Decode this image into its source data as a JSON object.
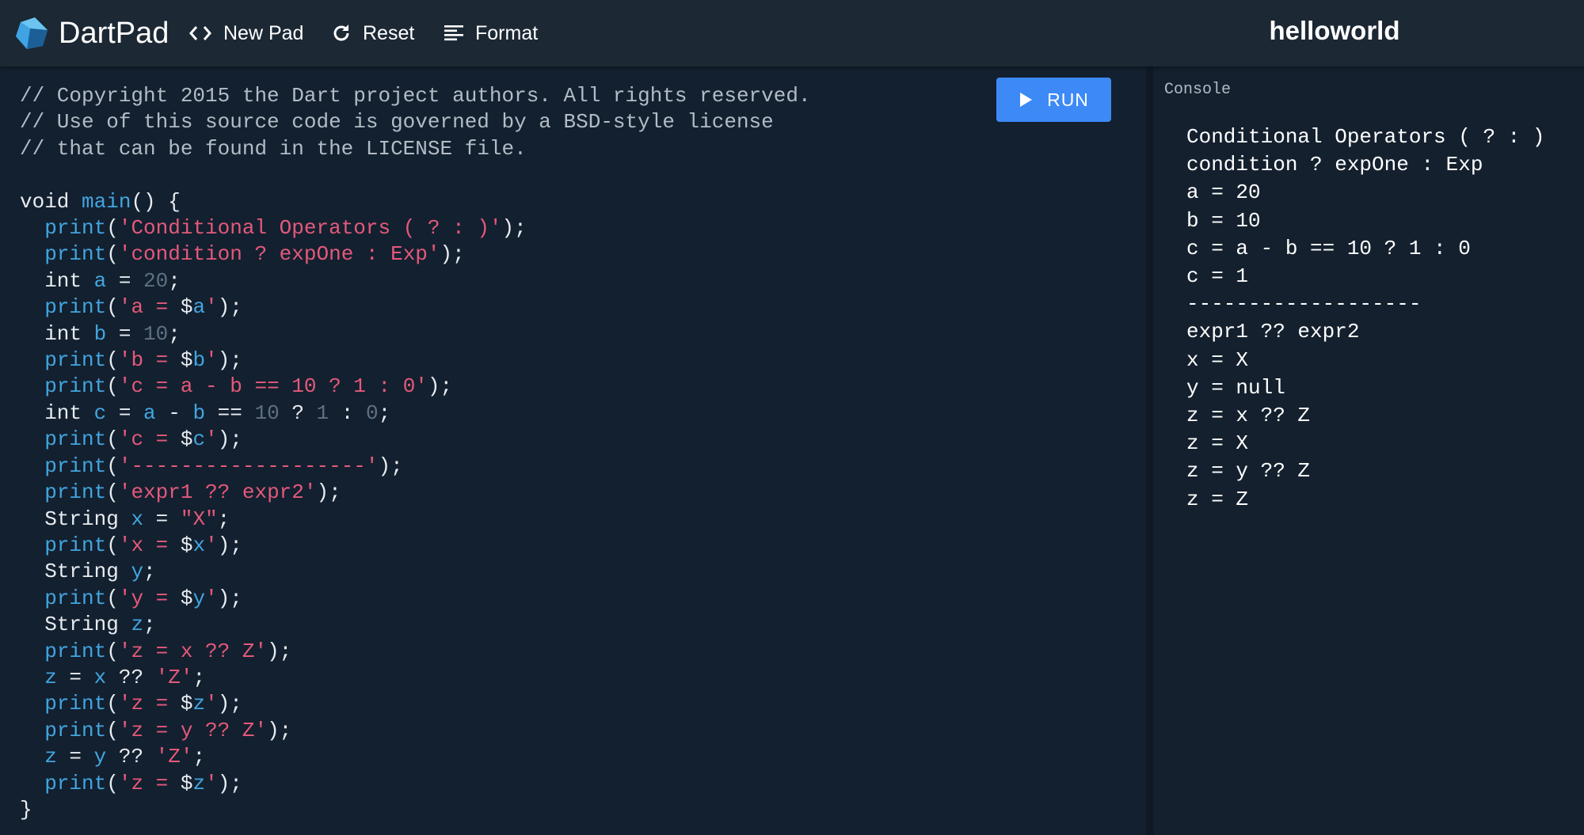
{
  "app": {
    "name": "DartPad",
    "pad_title": "helloworld"
  },
  "toolbar": {
    "new_pad_label": "New Pad",
    "new_pad_icon": "code-brackets-icon",
    "reset_label": "Reset",
    "reset_icon": "refresh-icon",
    "format_label": "Format",
    "format_icon": "align-left-icon"
  },
  "editor": {
    "run_label": "RUN",
    "run_icon": "play-icon",
    "lines": [
      [
        {
          "t": "cm",
          "v": "// Copyright 2015 the Dart project authors. All rights reserved."
        }
      ],
      [
        {
          "t": "cm",
          "v": "// Use of this source code is governed by a BSD-style license"
        }
      ],
      [
        {
          "t": "cm",
          "v": "// that can be found in the LICENSE file."
        }
      ],
      [],
      [
        {
          "t": "kw",
          "v": "void "
        },
        {
          "t": "fn",
          "v": "main"
        },
        {
          "t": "pu",
          "v": "() {"
        }
      ],
      [
        {
          "t": "pu",
          "v": "  "
        },
        {
          "t": "fn",
          "v": "print"
        },
        {
          "t": "pu",
          "v": "("
        },
        {
          "t": "st",
          "v": "'Conditional Operators ( ? : )'"
        },
        {
          "t": "pu",
          "v": ");"
        }
      ],
      [
        {
          "t": "pu",
          "v": "  "
        },
        {
          "t": "fn",
          "v": "print"
        },
        {
          "t": "pu",
          "v": "("
        },
        {
          "t": "st",
          "v": "'condition ? expOne : Exp'"
        },
        {
          "t": "pu",
          "v": ");"
        }
      ],
      [
        {
          "t": "kw",
          "v": "  int "
        },
        {
          "t": "vr",
          "v": "a"
        },
        {
          "t": "pu",
          "v": " = "
        },
        {
          "t": "nm",
          "v": "20"
        },
        {
          "t": "pu",
          "v": ";"
        }
      ],
      [
        {
          "t": "pu",
          "v": "  "
        },
        {
          "t": "fn",
          "v": "print"
        },
        {
          "t": "pu",
          "v": "("
        },
        {
          "t": "st",
          "v": "'a = "
        },
        {
          "t": "pu",
          "v": "$"
        },
        {
          "t": "vr",
          "v": "a"
        },
        {
          "t": "st",
          "v": "'"
        },
        {
          "t": "pu",
          "v": ");"
        }
      ],
      [
        {
          "t": "kw",
          "v": "  int "
        },
        {
          "t": "vr",
          "v": "b"
        },
        {
          "t": "pu",
          "v": " = "
        },
        {
          "t": "nm",
          "v": "10"
        },
        {
          "t": "pu",
          "v": ";"
        }
      ],
      [
        {
          "t": "pu",
          "v": "  "
        },
        {
          "t": "fn",
          "v": "print"
        },
        {
          "t": "pu",
          "v": "("
        },
        {
          "t": "st",
          "v": "'b = "
        },
        {
          "t": "pu",
          "v": "$"
        },
        {
          "t": "vr",
          "v": "b"
        },
        {
          "t": "st",
          "v": "'"
        },
        {
          "t": "pu",
          "v": ");"
        }
      ],
      [
        {
          "t": "pu",
          "v": "  "
        },
        {
          "t": "fn",
          "v": "print"
        },
        {
          "t": "pu",
          "v": "("
        },
        {
          "t": "st",
          "v": "'c = a - b == 10 ? 1 : 0'"
        },
        {
          "t": "pu",
          "v": ");"
        }
      ],
      [
        {
          "t": "kw",
          "v": "  int "
        },
        {
          "t": "vr",
          "v": "c"
        },
        {
          "t": "pu",
          "v": " = "
        },
        {
          "t": "vr",
          "v": "a"
        },
        {
          "t": "pu",
          "v": " - "
        },
        {
          "t": "vr",
          "v": "b"
        },
        {
          "t": "pu",
          "v": " == "
        },
        {
          "t": "nm",
          "v": "10"
        },
        {
          "t": "pu",
          "v": " ? "
        },
        {
          "t": "nm",
          "v": "1"
        },
        {
          "t": "pu",
          "v": " : "
        },
        {
          "t": "nm",
          "v": "0"
        },
        {
          "t": "pu",
          "v": ";"
        }
      ],
      [
        {
          "t": "pu",
          "v": "  "
        },
        {
          "t": "fn",
          "v": "print"
        },
        {
          "t": "pu",
          "v": "("
        },
        {
          "t": "st",
          "v": "'c = "
        },
        {
          "t": "pu",
          "v": "$"
        },
        {
          "t": "vr",
          "v": "c"
        },
        {
          "t": "st",
          "v": "'"
        },
        {
          "t": "pu",
          "v": ");"
        }
      ],
      [
        {
          "t": "pu",
          "v": "  "
        },
        {
          "t": "fn",
          "v": "print"
        },
        {
          "t": "pu",
          "v": "("
        },
        {
          "t": "st",
          "v": "'-------------------'"
        },
        {
          "t": "pu",
          "v": ");"
        }
      ],
      [
        {
          "t": "pu",
          "v": "  "
        },
        {
          "t": "fn",
          "v": "print"
        },
        {
          "t": "pu",
          "v": "("
        },
        {
          "t": "st",
          "v": "'expr1 ?? expr2'"
        },
        {
          "t": "pu",
          "v": ");"
        }
      ],
      [
        {
          "t": "kw",
          "v": "  String "
        },
        {
          "t": "vr",
          "v": "x"
        },
        {
          "t": "pu",
          "v": " = "
        },
        {
          "t": "st",
          "v": "\"X\""
        },
        {
          "t": "pu",
          "v": ";"
        }
      ],
      [
        {
          "t": "pu",
          "v": "  "
        },
        {
          "t": "fn",
          "v": "print"
        },
        {
          "t": "pu",
          "v": "("
        },
        {
          "t": "st",
          "v": "'x = "
        },
        {
          "t": "pu",
          "v": "$"
        },
        {
          "t": "vr",
          "v": "x"
        },
        {
          "t": "st",
          "v": "'"
        },
        {
          "t": "pu",
          "v": ");"
        }
      ],
      [
        {
          "t": "kw",
          "v": "  String "
        },
        {
          "t": "vr",
          "v": "y"
        },
        {
          "t": "pu",
          "v": ";"
        }
      ],
      [
        {
          "t": "pu",
          "v": "  "
        },
        {
          "t": "fn",
          "v": "print"
        },
        {
          "t": "pu",
          "v": "("
        },
        {
          "t": "st",
          "v": "'y = "
        },
        {
          "t": "pu",
          "v": "$"
        },
        {
          "t": "vr",
          "v": "y"
        },
        {
          "t": "st",
          "v": "'"
        },
        {
          "t": "pu",
          "v": ");"
        }
      ],
      [
        {
          "t": "kw",
          "v": "  String "
        },
        {
          "t": "vr",
          "v": "z"
        },
        {
          "t": "pu",
          "v": ";"
        }
      ],
      [
        {
          "t": "pu",
          "v": "  "
        },
        {
          "t": "fn",
          "v": "print"
        },
        {
          "t": "pu",
          "v": "("
        },
        {
          "t": "st",
          "v": "'z = x ?? Z'"
        },
        {
          "t": "pu",
          "v": ");"
        }
      ],
      [
        {
          "t": "pu",
          "v": "  "
        },
        {
          "t": "vr",
          "v": "z"
        },
        {
          "t": "pu",
          "v": " = "
        },
        {
          "t": "vr",
          "v": "x"
        },
        {
          "t": "pu",
          "v": " ?? "
        },
        {
          "t": "st",
          "v": "'Z'"
        },
        {
          "t": "pu",
          "v": ";"
        }
      ],
      [
        {
          "t": "pu",
          "v": "  "
        },
        {
          "t": "fn",
          "v": "print"
        },
        {
          "t": "pu",
          "v": "("
        },
        {
          "t": "st",
          "v": "'z = "
        },
        {
          "t": "pu",
          "v": "$"
        },
        {
          "t": "vr",
          "v": "z"
        },
        {
          "t": "st",
          "v": "'"
        },
        {
          "t": "pu",
          "v": ");"
        }
      ],
      [
        {
          "t": "pu",
          "v": "  "
        },
        {
          "t": "fn",
          "v": "print"
        },
        {
          "t": "pu",
          "v": "("
        },
        {
          "t": "st",
          "v": "'z = y ?? Z'"
        },
        {
          "t": "pu",
          "v": ");"
        }
      ],
      [
        {
          "t": "pu",
          "v": "  "
        },
        {
          "t": "vr",
          "v": "z"
        },
        {
          "t": "pu",
          "v": " = "
        },
        {
          "t": "vr",
          "v": "y"
        },
        {
          "t": "pu",
          "v": " ?? "
        },
        {
          "t": "st",
          "v": "'Z'"
        },
        {
          "t": "pu",
          "v": ";"
        }
      ],
      [
        {
          "t": "pu",
          "v": "  "
        },
        {
          "t": "fn",
          "v": "print"
        },
        {
          "t": "pu",
          "v": "("
        },
        {
          "t": "st",
          "v": "'z = "
        },
        {
          "t": "pu",
          "v": "$"
        },
        {
          "t": "vr",
          "v": "z"
        },
        {
          "t": "st",
          "v": "'"
        },
        {
          "t": "pu",
          "v": ");"
        }
      ],
      [
        {
          "t": "pu",
          "v": "}"
        }
      ]
    ]
  },
  "console": {
    "label": "Console",
    "output_lines": [
      "Conditional Operators ( ? : )",
      "condition ? expOne : Exp",
      "a = 20",
      "b = 10",
      "c = a - b == 10 ? 1 : 0",
      "c = 1",
      "-------------------",
      "expr1 ?? expr2",
      "x = X",
      "y = null",
      "z = x ?? Z",
      "z = X",
      "z = y ?? Z",
      "z = Z"
    ]
  },
  "colors": {
    "run_button": "#3d8af7",
    "string": "#e5597b",
    "identifier": "#42a5e0",
    "number": "#5f7181",
    "comment": "#b3bcc6",
    "background": "#13202f",
    "topbar": "#1c2834"
  }
}
